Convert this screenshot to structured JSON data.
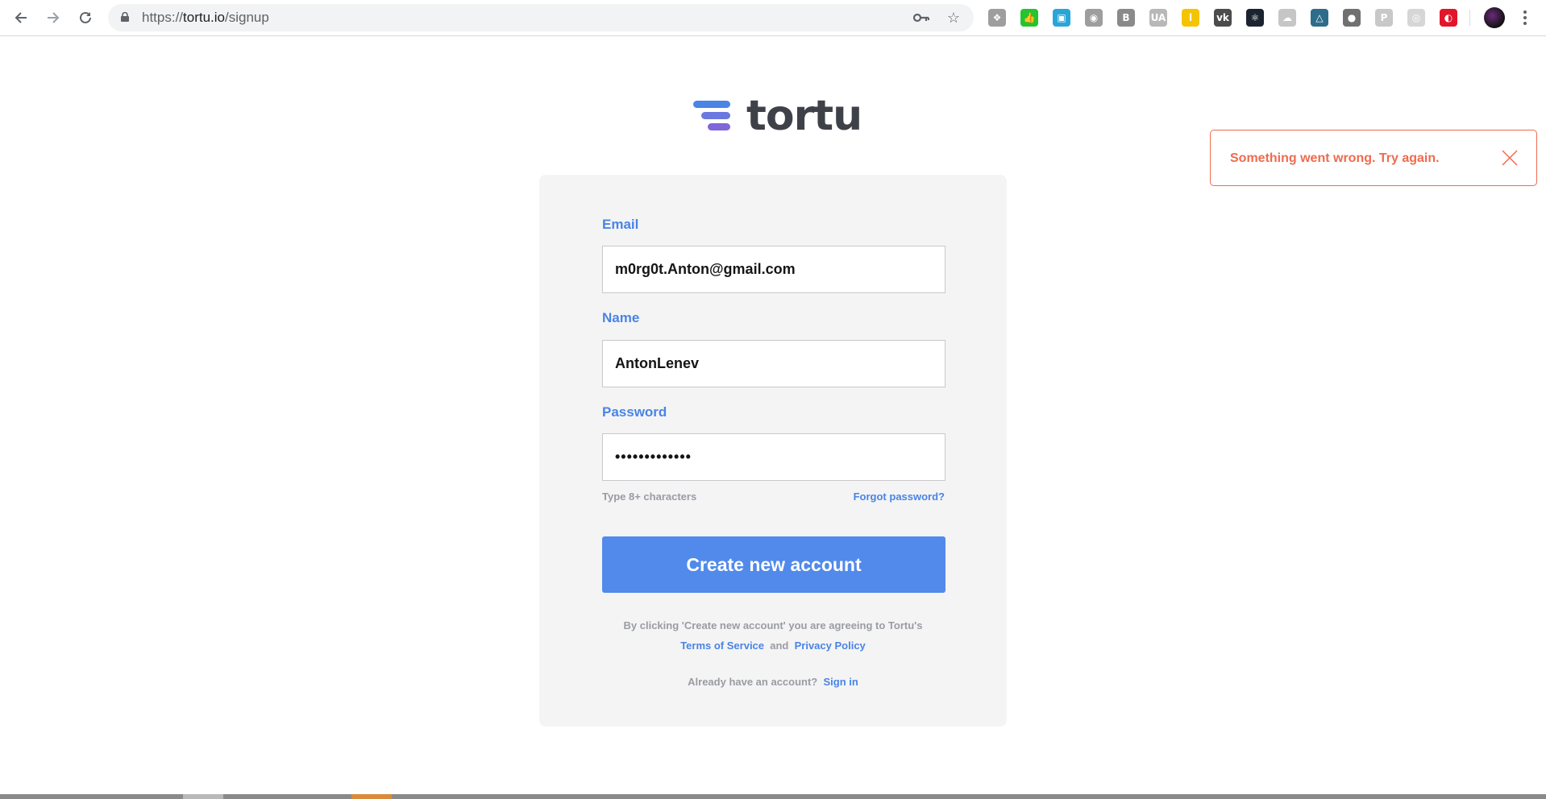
{
  "browser": {
    "url_scheme": "https://",
    "url_host": "tortu.io",
    "url_path": "/signup",
    "extensions": [
      {
        "icon": "paw-icon",
        "color": "#9e9e9e",
        "glyph": "❖"
      },
      {
        "icon": "thumb-up-icon",
        "color": "#23c42f",
        "glyph": "👍"
      },
      {
        "icon": "screen-capture-icon",
        "color": "#29a6d8",
        "glyph": "▣"
      },
      {
        "icon": "camera-icon",
        "color": "#9e9e9e",
        "glyph": "◉"
      },
      {
        "icon": "b-icon",
        "color": "#8a8a8a",
        "glyph": "B"
      },
      {
        "icon": "ua-icon",
        "color": "#b8b8b8",
        "glyph": "UA"
      },
      {
        "icon": "l-icon",
        "color": "#f5c400",
        "glyph": "l"
      },
      {
        "icon": "vk-icon",
        "color": "#4c4c4c",
        "glyph": "vk"
      },
      {
        "icon": "react-icon",
        "color": "#1a2430",
        "glyph": "⚛"
      },
      {
        "icon": "cloud-icon",
        "color": "#c6c6c6",
        "glyph": "☁"
      },
      {
        "icon": "triangle-icon",
        "color": "#2e6d8a",
        "glyph": "△"
      },
      {
        "icon": "globe-icon",
        "color": "#707070",
        "glyph": "●"
      },
      {
        "icon": "p-icon",
        "color": "#c8c8c8",
        "glyph": "P"
      },
      {
        "icon": "circle-icon",
        "color": "#d6d6d6",
        "glyph": "◎"
      },
      {
        "icon": "red-circle-icon",
        "color": "#e2162b",
        "glyph": "◐"
      }
    ]
  },
  "logo": {
    "text": "tortu"
  },
  "form": {
    "email_label": "Email",
    "email_value": "m0rg0t.Anton@gmail.com",
    "name_label": "Name",
    "name_value": "AntonLenev",
    "password_label": "Password",
    "password_value": "•••••••••••••",
    "password_hint": "Type 8+ characters",
    "forgot_link": "Forgot password?",
    "submit_label": "Create new account",
    "legal_text": "By clicking 'Create new account' you are agreeing to Tortu's",
    "terms_link": "Terms of Service",
    "legal_and": "and",
    "privacy_link": "Privacy Policy",
    "signin_prompt": "Already have an account?",
    "signin_link": "Sign in"
  },
  "toast": {
    "message": "Something went wrong. Try again.",
    "color": "#ef6b4e"
  },
  "colors": {
    "accent": "#518aea",
    "label": "#4a84e4",
    "card_bg": "#f4f4f5"
  }
}
